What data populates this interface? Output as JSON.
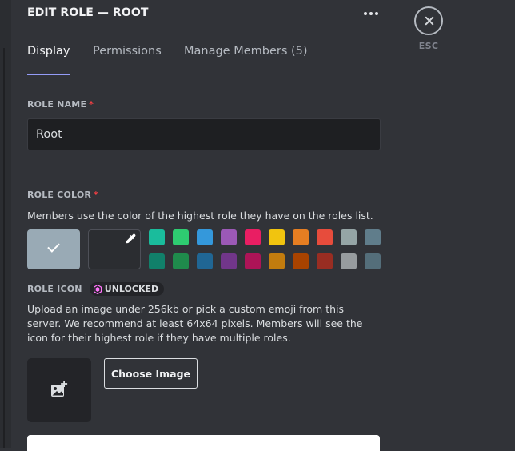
{
  "header": {
    "title": "EDIT ROLE — ROOT",
    "more_icon": "ellipsis-icon"
  },
  "tabs": [
    {
      "label": "Display",
      "active": true
    },
    {
      "label": "Permissions",
      "active": false
    },
    {
      "label": "Manage Members (5)",
      "active": false
    }
  ],
  "role_name": {
    "label": "ROLE NAME",
    "required_mark": "*",
    "value": "Root"
  },
  "role_color": {
    "label": "ROLE COLOR",
    "required_mark": "*",
    "description": "Members use the color of the highest role they have on the roles list.",
    "default_color": "#99aab5",
    "custom_icon": "eyedropper-icon",
    "palette_row_1": [
      "#1abc9c",
      "#2ecc71",
      "#3498db",
      "#9b59b6",
      "#e91e63",
      "#f1c40f",
      "#e67e22",
      "#e74c3c",
      "#95a5a6",
      "#607d8b"
    ],
    "palette_row_2": [
      "#11806a",
      "#1f8b4c",
      "#206694",
      "#71368a",
      "#ad1457",
      "#c27c0e",
      "#a84300",
      "#992d22",
      "#979c9f",
      "#546e7a"
    ]
  },
  "role_icon": {
    "label": "ROLE ICON",
    "badge": "UNLOCKED",
    "description": "Upload an image under 256kb or pick a custom emoji from this server. We recommend at least 64x64 pixels. Members will see the icon for their highest role if they have multiple roles.",
    "choose_button": "Choose Image"
  },
  "close": {
    "label": "ESC"
  },
  "colors": {
    "background": "#313338",
    "input_bg": "#1e1f22",
    "active_tab_underline": "#949cf7",
    "required": "#f23f43",
    "badge_gem": "#ff73fa"
  }
}
